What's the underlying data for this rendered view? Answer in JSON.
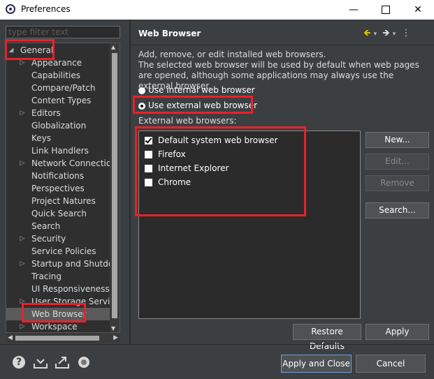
{
  "window": {
    "title": "Preferences",
    "min": "—",
    "close": "✕"
  },
  "filter": {
    "placeholder": "type filter text"
  },
  "tree": {
    "root": "General",
    "items": [
      "Appearance",
      "Capabilities",
      "Compare/Patch",
      "Content Types",
      "Editors",
      "Globalization",
      "Keys",
      "Link Handlers",
      "Network Connections",
      "Notifications",
      "Perspectives",
      "Project Natures",
      "Quick Search",
      "Search",
      "Security",
      "Service Policies",
      "Startup and Shutdown",
      "Tracing",
      "UI Responsiveness M",
      "User Storage Service",
      "Web Browser",
      "Workspace"
    ],
    "selected": "Web Browser"
  },
  "page": {
    "title": "Web Browser",
    "desc1": "Add, remove, or edit installed web browsers.",
    "desc2": "The selected web browser will be used by default when web pages are opened, although some applications may always use the external browser.",
    "radio_internal": "Use internal web browser",
    "radio_external": "Use external web browser",
    "external_label": "External web browsers:",
    "browsers": [
      {
        "name": "Default system web browser",
        "checked": true
      },
      {
        "name": "Firefox",
        "checked": false
      },
      {
        "name": "Internet Explorer",
        "checked": false
      },
      {
        "name": "Chrome",
        "checked": false
      }
    ],
    "btn_new": "New...",
    "btn_edit": "Edit...",
    "btn_remove": "Remove",
    "btn_search": "Search...",
    "btn_restore": "Restore Defaults",
    "btn_apply": "Apply"
  },
  "footer": {
    "apply_close": "Apply and Close",
    "cancel": "Cancel"
  },
  "colors": {
    "highlight": "#e8222a",
    "background": "#3c3f41"
  }
}
